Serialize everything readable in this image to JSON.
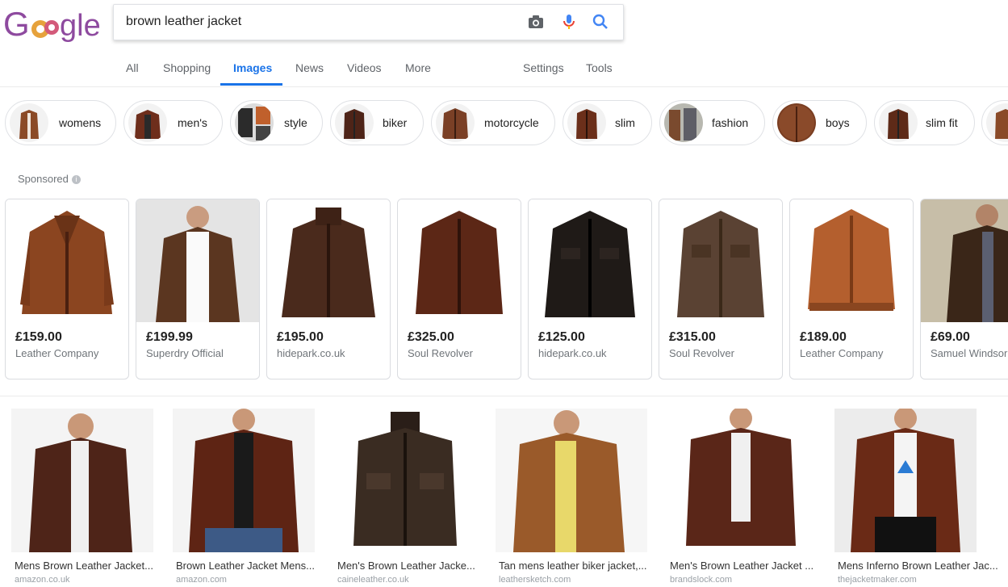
{
  "colors": {
    "accent": "#1a73e8",
    "jacket_dark": "#5a2e1c",
    "jacket_mid": "#7a3d22",
    "jacket_light": "#a0552b"
  },
  "logo": {
    "text": "Google",
    "letters": [
      "G",
      "o",
      "o",
      "g",
      "l",
      "e"
    ]
  },
  "search": {
    "query": "brown leather jacket",
    "camera_icon": "camera-icon",
    "mic_icon": "microphone-icon",
    "search_icon": "search-icon"
  },
  "tabs": [
    {
      "label": "All"
    },
    {
      "label": "Shopping"
    },
    {
      "label": "Images",
      "active": true
    },
    {
      "label": "News"
    },
    {
      "label": "Videos"
    },
    {
      "label": "More"
    }
  ],
  "tools": [
    {
      "label": "Settings"
    },
    {
      "label": "Tools"
    }
  ],
  "chips": [
    {
      "label": "womens"
    },
    {
      "label": "men's"
    },
    {
      "label": "style"
    },
    {
      "label": "biker"
    },
    {
      "label": "motorcycle"
    },
    {
      "label": "slim"
    },
    {
      "label": "fashion"
    },
    {
      "label": "boys"
    },
    {
      "label": "slim fit"
    }
  ],
  "sponsored": {
    "label": "Sponsored",
    "info": "i"
  },
  "products": [
    {
      "price": "£159.00",
      "shop": "Leather Company"
    },
    {
      "price": "£199.99",
      "shop": "Superdry Official"
    },
    {
      "price": "£195.00",
      "shop": "hidepark.co.uk"
    },
    {
      "price": "£325.00",
      "shop": "Soul Revolver"
    },
    {
      "price": "£125.00",
      "shop": "hidepark.co.uk"
    },
    {
      "price": "£315.00",
      "shop": "Soul Revolver"
    },
    {
      "price": "£189.00",
      "shop": "Leather Company"
    },
    {
      "price": "£69.00",
      "shop": "Samuel Windsor"
    }
  ],
  "results": [
    {
      "title": "Mens Brown Leather Jacket...",
      "site": "amazon.co.uk"
    },
    {
      "title": "Brown Leather Jacket Mens...",
      "site": "amazon.com"
    },
    {
      "title": "Men's Brown Leather Jacke...",
      "site": "caineleather.co.uk"
    },
    {
      "title": "Tan mens leather biker jacket,...",
      "site": "leathersketch.com"
    },
    {
      "title": "Men's Brown Leather Jacket ...",
      "site": "brandslock.com"
    },
    {
      "title": "Mens Inferno Brown Leather Jac...",
      "site": "thejacketmaker.com"
    }
  ]
}
